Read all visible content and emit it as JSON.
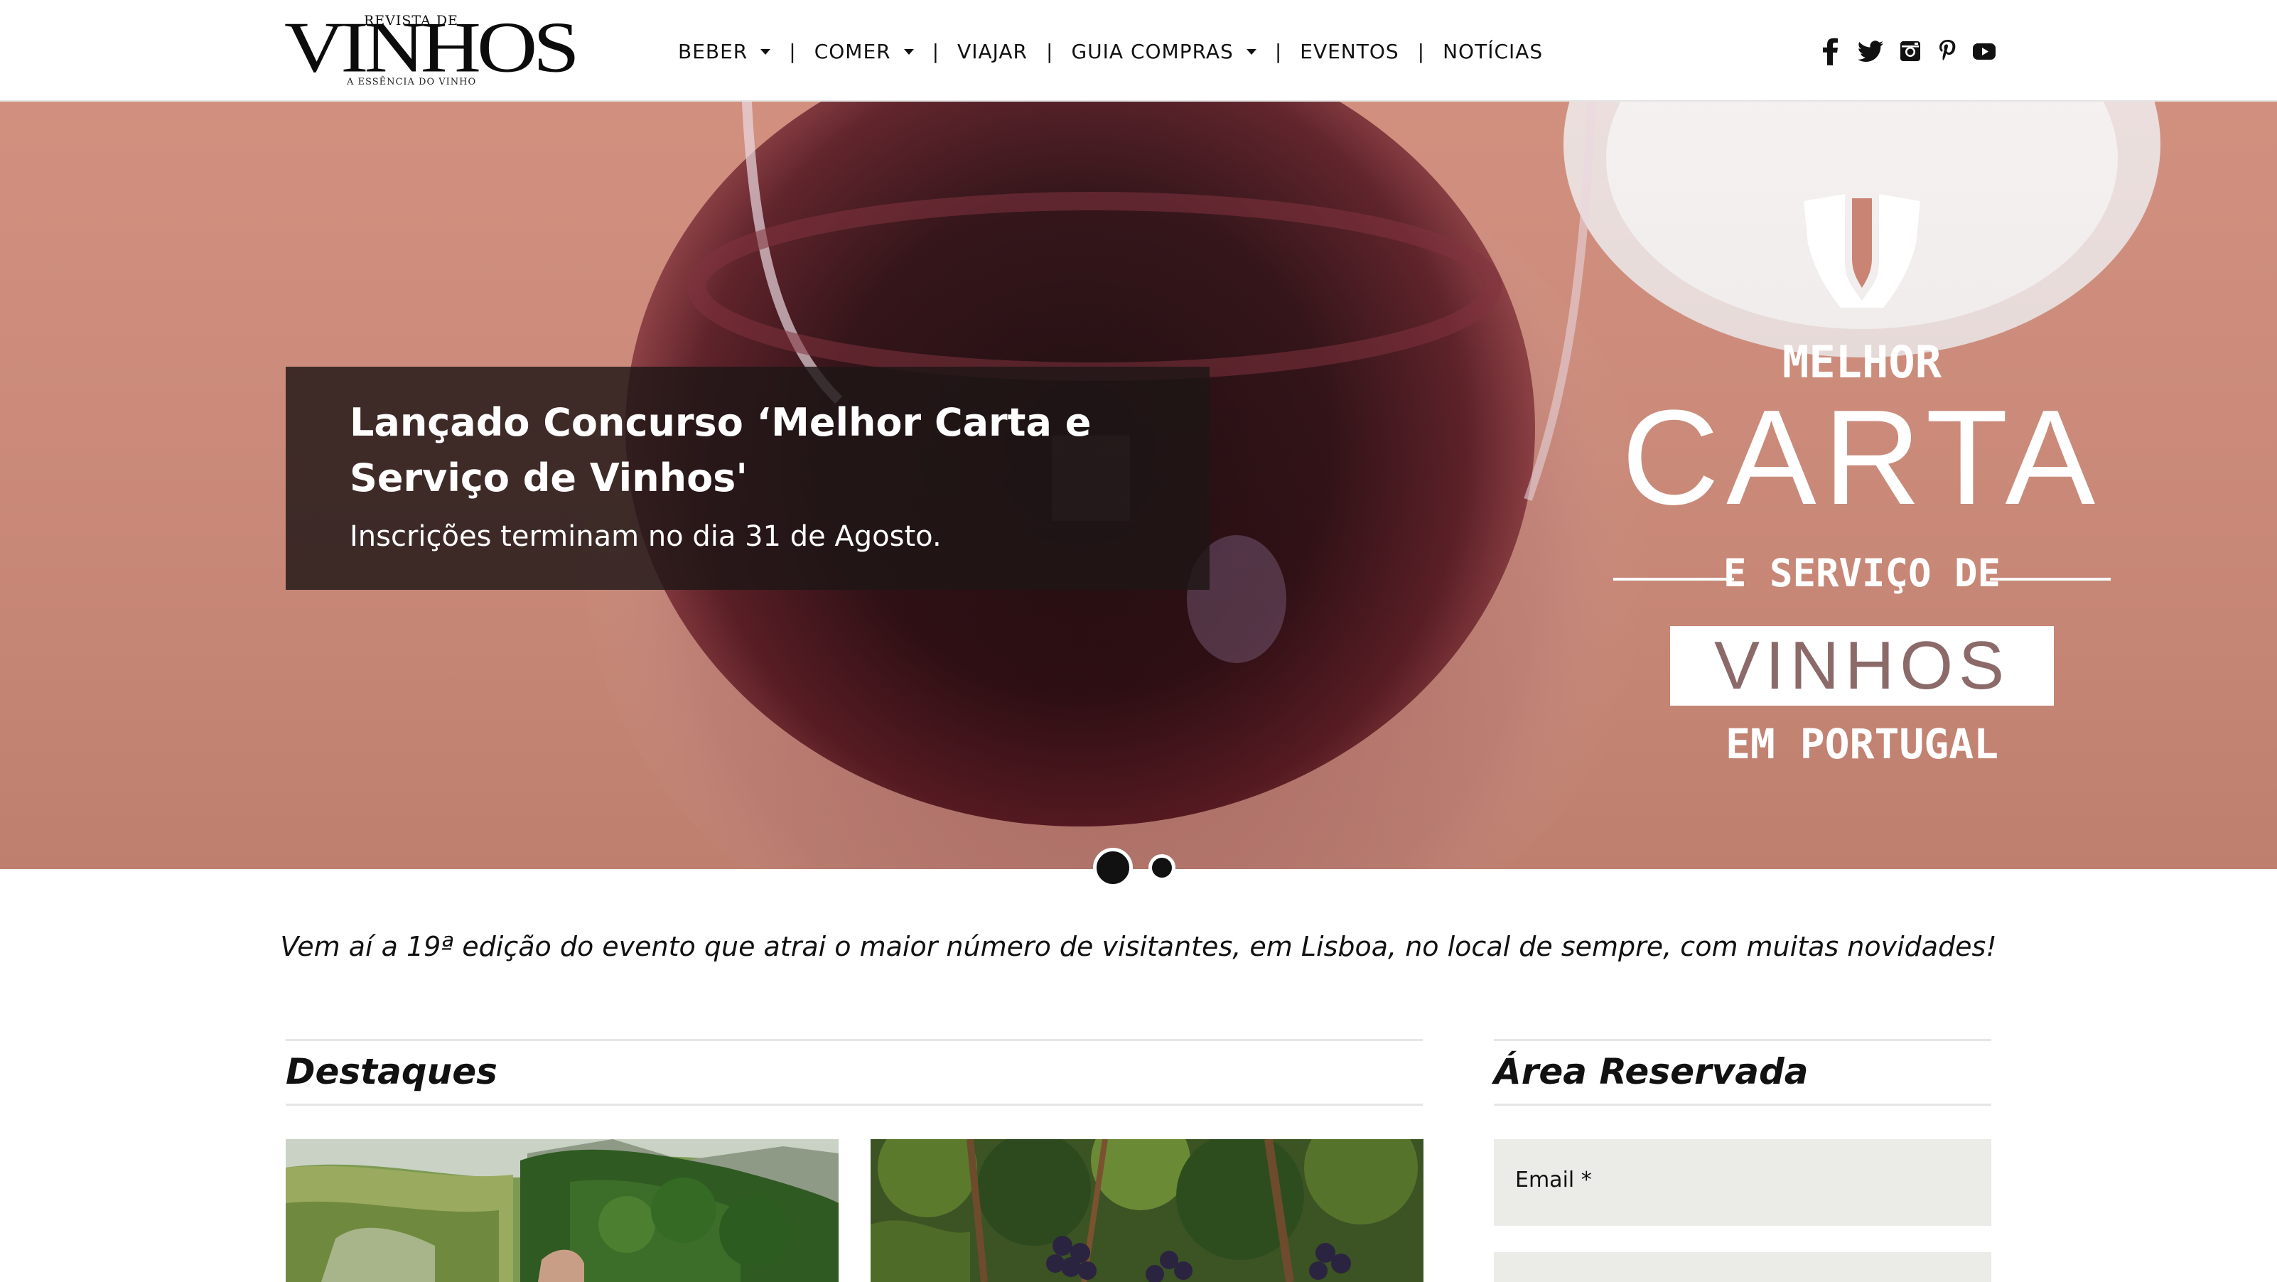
{
  "logo": {
    "top_text": "REVISTA DE",
    "main_text": "VINHOS",
    "tagline": "A ESSÊNCIA DO VINHO"
  },
  "nav": {
    "items": [
      {
        "label": "BEBER",
        "dropdown": true
      },
      {
        "label": "COMER",
        "dropdown": true
      },
      {
        "label": "VIAJAR",
        "dropdown": false
      },
      {
        "label": "GUIA COMPRAS",
        "dropdown": true
      },
      {
        "label": "EVENTOS",
        "dropdown": false
      },
      {
        "label": "NOTÍCIAS",
        "dropdown": false
      }
    ],
    "separator": "|"
  },
  "social": [
    "facebook-icon",
    "twitter-icon",
    "instagram-icon",
    "pinterest-icon",
    "youtube-icon"
  ],
  "hero": {
    "title": "Lançado Concurso ‘Melhor Carta e Serviço de Vinhos'",
    "subtitle": "Inscrições terminam no dia 31 de Agosto.",
    "promo": {
      "line1": "MELHOR",
      "line2": "CARTA",
      "line3": "E SERVIÇO DE",
      "line4": "VINHOS",
      "line5": "EM PORTUGAL"
    },
    "slides_total": 2,
    "slide_active": 1
  },
  "intro": "Vem aí a 19ª edição do evento que atrai o maior número de visitantes, em Lisboa, no local de sempre, com muitas novidades!",
  "destaques": {
    "title": "Destaques"
  },
  "reserved": {
    "title": "Área Reservada",
    "email_label": "Email *"
  },
  "colors": {
    "overlay": "#1e1616",
    "field_bg": "#ebebe8",
    "divider": "#e6e6e6"
  }
}
